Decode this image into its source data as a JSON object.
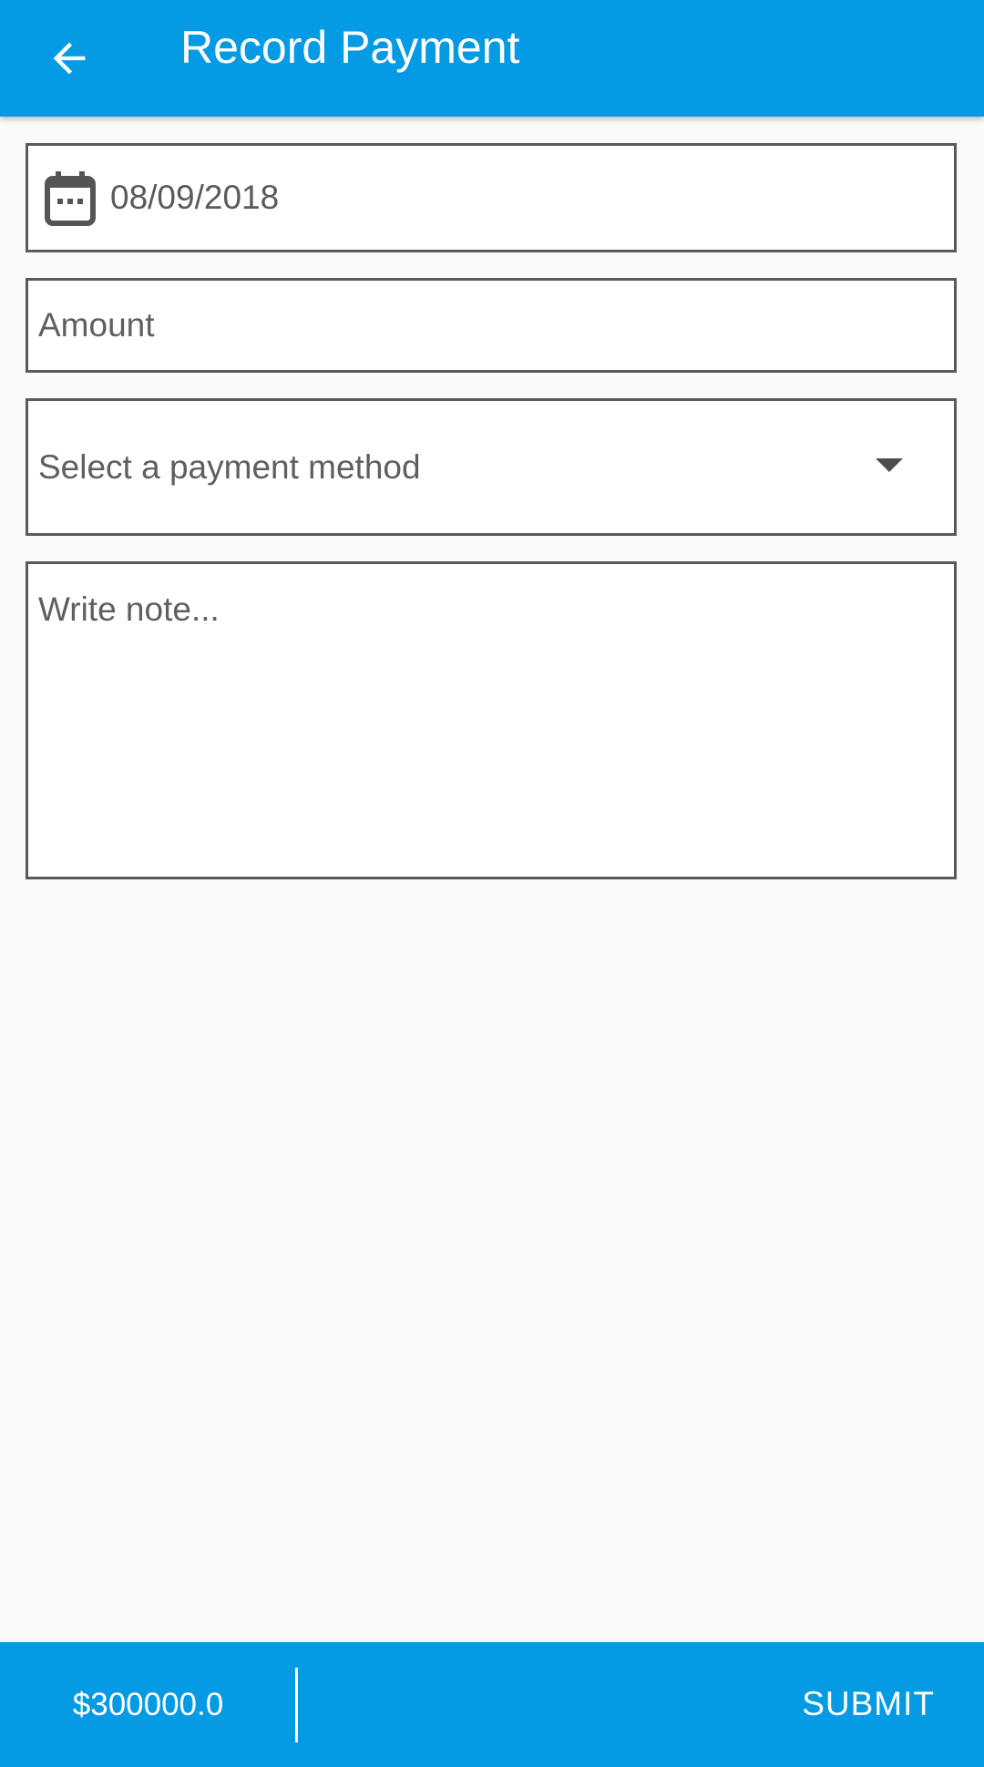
{
  "app_bar": {
    "title": "Record Payment",
    "back_icon": "arrow-back-icon",
    "background_color": "#049ae4"
  },
  "form": {
    "date": {
      "icon": "calendar-icon",
      "value": "08/09/2018"
    },
    "amount": {
      "value": "",
      "placeholder": "Amount"
    },
    "payment_method": {
      "selected": "Select a payment method",
      "icon": "dropdown-arrow-icon"
    },
    "note": {
      "value": "",
      "placeholder": "Write note..."
    }
  },
  "bottom_bar": {
    "total": "$300000.0",
    "submit_label": "SUBMIT",
    "background_color": "#049ae4"
  }
}
